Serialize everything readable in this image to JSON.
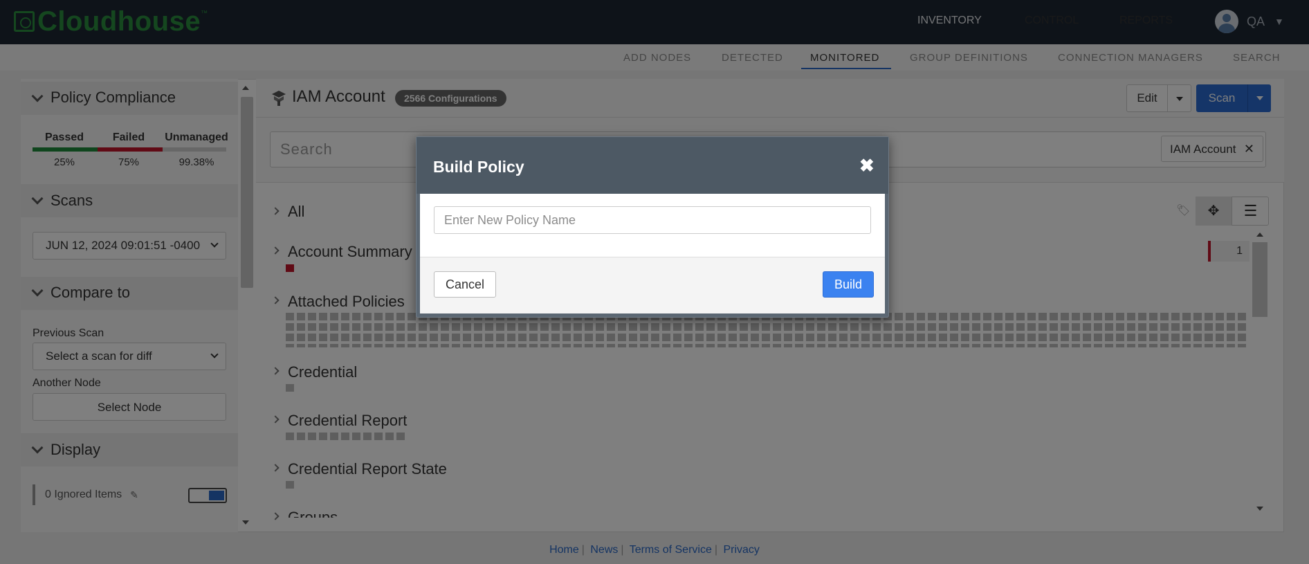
{
  "app": {
    "brand": "Cloudhouse",
    "trademark": "™"
  },
  "top_nav": {
    "items": [
      {
        "label": "INVENTORY",
        "active": true
      },
      {
        "label": "CONTROL",
        "active": false
      },
      {
        "label": "REPORTS",
        "active": false
      }
    ],
    "user": {
      "name": "QA"
    }
  },
  "sub_nav": {
    "items": [
      {
        "label": "ADD NODES"
      },
      {
        "label": "DETECTED"
      },
      {
        "label": "MONITORED",
        "active": true
      },
      {
        "label": "GROUP DEFINITIONS"
      },
      {
        "label": "CONNECTION MANAGERS"
      },
      {
        "label": "SEARCH"
      }
    ]
  },
  "sidebar": {
    "policy_compliance": {
      "title": "Policy Compliance",
      "columns": [
        {
          "label": "Passed",
          "value": "25%",
          "color": "#1e8a3a"
        },
        {
          "label": "Failed",
          "value": "75%",
          "color": "#c0152a"
        },
        {
          "label": "Unmanaged",
          "value": "99.38%",
          "color": "#cfcfcf"
        }
      ]
    },
    "scans": {
      "title": "Scans",
      "selected": "JUN 12, 2024 09:01:51 -0400"
    },
    "compare_to": {
      "title": "Compare to",
      "previous_scan_label": "Previous Scan",
      "previous_scan_value": "Select a scan for diff",
      "another_node_label": "Another Node",
      "select_node_label": "Select Node"
    },
    "display": {
      "title": "Display",
      "ignored_items": "0 Ignored Items"
    }
  },
  "main": {
    "title": "IAM Account",
    "config_badge": "2566 Configurations",
    "edit_label": "Edit",
    "scan_label": "Scan",
    "search_placeholder": "Search",
    "filter_chip": "IAM Account",
    "tree": [
      {
        "label": "All"
      },
      {
        "label": "Account Summary"
      },
      {
        "label": "Attached Policies"
      },
      {
        "label": "Credential"
      },
      {
        "label": "Credential Report"
      },
      {
        "label": "Credential Report State"
      },
      {
        "label": "Groups"
      }
    ],
    "count_value": "1"
  },
  "footer": {
    "links": [
      "Home",
      "News",
      "Terms of Service",
      "Privacy"
    ],
    "separator": "|"
  },
  "modal": {
    "title": "Build Policy",
    "input_placeholder": "Enter New Policy Name",
    "cancel_label": "Cancel",
    "build_label": "Build",
    "close_glyph": "✖"
  },
  "colors": {
    "accent": "#2b6bd1",
    "brand": "#2a8f3f",
    "danger": "#c0152a"
  }
}
